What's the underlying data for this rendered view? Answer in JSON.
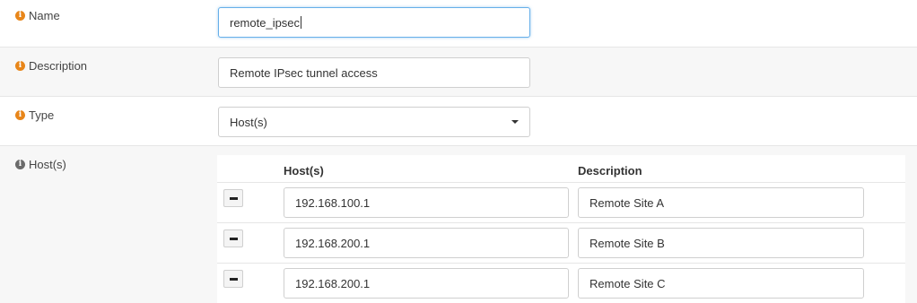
{
  "fields": {
    "name": {
      "label": "Name",
      "value": "remote_ipsec"
    },
    "description": {
      "label": "Description",
      "value": "Remote IPsec tunnel access"
    },
    "type": {
      "label": "Type",
      "value": "Host(s)"
    },
    "hosts": {
      "label": "Host(s)"
    }
  },
  "hosts_table": {
    "columns": [
      "Host(s)",
      "Description"
    ],
    "rows": [
      {
        "host": "192.168.100.1",
        "description": "Remote Site A"
      },
      {
        "host": "192.168.200.1",
        "description": "Remote Site B"
      },
      {
        "host": "192.168.200.1",
        "description": "Remote Site C"
      }
    ]
  },
  "icons": {
    "info": "info-icon",
    "remove": "minus-icon",
    "dropdown": "caret-down-icon"
  },
  "colors": {
    "info_orange": "#e8861a",
    "info_grey": "#6b6b6b",
    "focus_border": "#66afe9",
    "row_alt_bg": "#f7f7f7"
  }
}
